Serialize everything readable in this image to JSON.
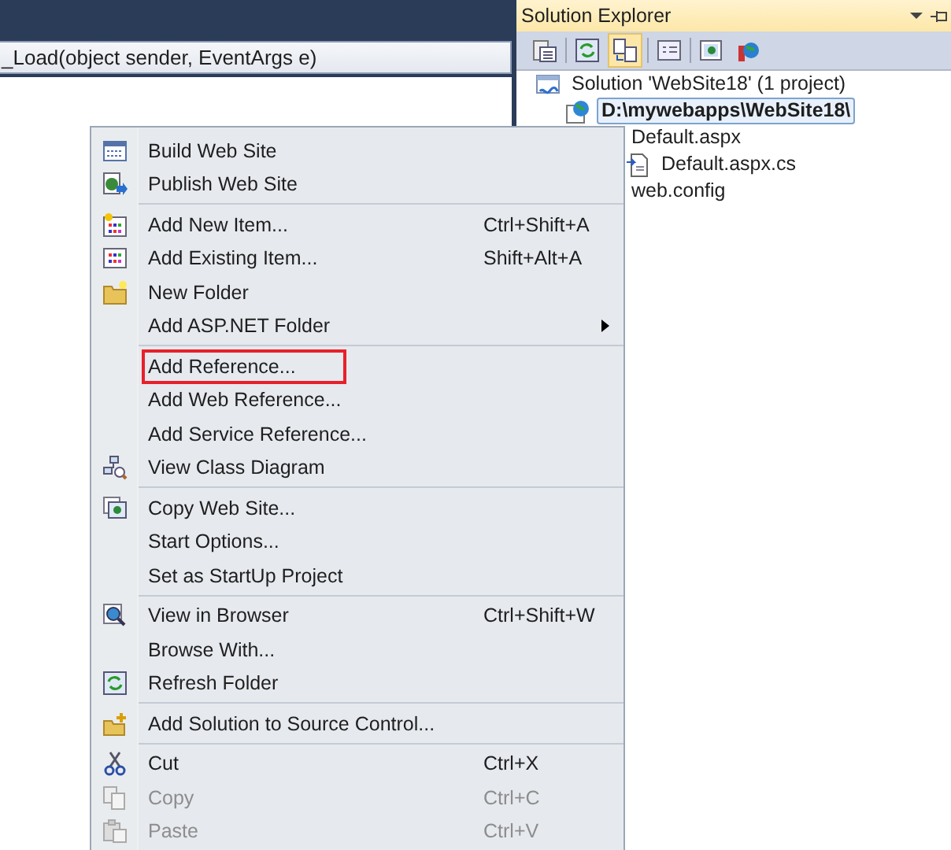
{
  "editor": {
    "member_dropdown": "_Load(object sender, EventArgs e)"
  },
  "solution_explorer": {
    "title": "Solution Explorer",
    "tree": [
      {
        "label": "Solution 'WebSite18' (1 project)",
        "kind": "solution",
        "selected": false,
        "children": [
          {
            "label": "D:\\mywebapps\\WebSite18\\",
            "kind": "project",
            "selected": true,
            "children": [
              {
                "label": "Default.aspx",
                "selected": false,
                "children": [
                  {
                    "label": "Default.aspx.cs",
                    "kind": "code",
                    "selected": false
                  }
                ]
              },
              {
                "label": "web.config",
                "selected": false
              }
            ]
          }
        ]
      }
    ]
  },
  "context_menu": {
    "groups": [
      [
        {
          "label": "Build Web Site",
          "disabled": false,
          "highlighted": false
        },
        {
          "label": "Publish Web Site",
          "disabled": false,
          "highlighted": false
        }
      ],
      [
        {
          "label": "Add New Item...",
          "shortcut": "Ctrl+Shift+A",
          "disabled": false,
          "highlighted": false
        },
        {
          "label": "Add Existing Item...",
          "shortcut": "Shift+Alt+A",
          "disabled": false,
          "highlighted": false
        },
        {
          "label": "New Folder",
          "disabled": false,
          "highlighted": false
        },
        {
          "label": "Add ASP.NET Folder",
          "submenu": true,
          "disabled": false,
          "highlighted": false
        }
      ],
      [
        {
          "label": "Add Reference...",
          "disabled": false,
          "highlighted": true
        },
        {
          "label": "Add Web Reference...",
          "disabled": false,
          "highlighted": false
        },
        {
          "label": "Add Service Reference...",
          "disabled": false,
          "highlighted": false
        },
        {
          "label": "View Class Diagram",
          "disabled": false,
          "highlighted": false
        }
      ],
      [
        {
          "label": "Copy Web Site...",
          "disabled": false,
          "highlighted": false
        },
        {
          "label": "Start Options...",
          "disabled": false,
          "highlighted": false
        },
        {
          "label": "Set as StartUp Project",
          "disabled": false,
          "highlighted": false
        }
      ],
      [
        {
          "label": "View in Browser",
          "shortcut": "Ctrl+Shift+W",
          "disabled": false,
          "highlighted": false
        },
        {
          "label": "Browse With...",
          "disabled": false,
          "highlighted": false
        },
        {
          "label": "Refresh Folder",
          "disabled": false,
          "highlighted": false
        }
      ],
      [
        {
          "label": "Add Solution to Source Control...",
          "disabled": false,
          "highlighted": false
        }
      ],
      [
        {
          "label": "Cut",
          "shortcut": "Ctrl+X",
          "disabled": false,
          "highlighted": false
        },
        {
          "label": "Copy",
          "shortcut": "Ctrl+C",
          "disabled": true,
          "highlighted": false
        },
        {
          "label": "Paste",
          "shortcut": "Ctrl+V",
          "disabled": true,
          "highlighted": false
        }
      ]
    ]
  }
}
